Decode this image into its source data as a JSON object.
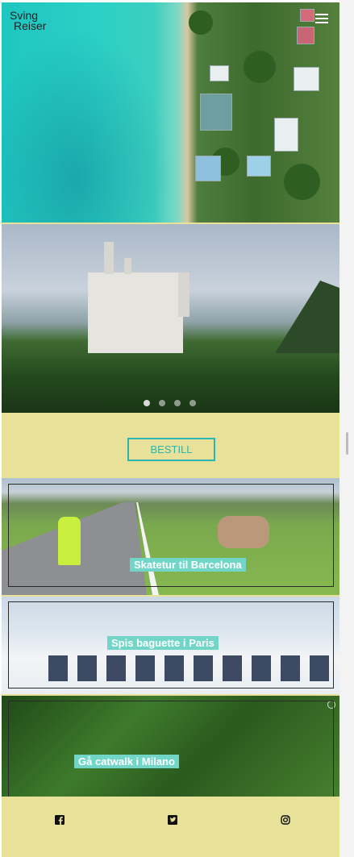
{
  "brand": {
    "line1": "Sving",
    "line2": "Reiser"
  },
  "nav": {
    "menu_icon": "hamburger-icon"
  },
  "carousel": {
    "slide_count": 4,
    "active_index": 0
  },
  "cta": {
    "label": "BESTILL"
  },
  "tiles": [
    {
      "caption": "Skatetur til Barcelona"
    },
    {
      "caption": "Spis baguette i Paris"
    },
    {
      "caption": "Gå catwalk i Milano"
    }
  ],
  "footer": {
    "icons": [
      "facebook-icon",
      "twitter-icon",
      "instagram-icon"
    ]
  },
  "colors": {
    "background": "#e7e19a",
    "accent": "#2ab5b0",
    "caption_bg": "#71d6c7"
  }
}
